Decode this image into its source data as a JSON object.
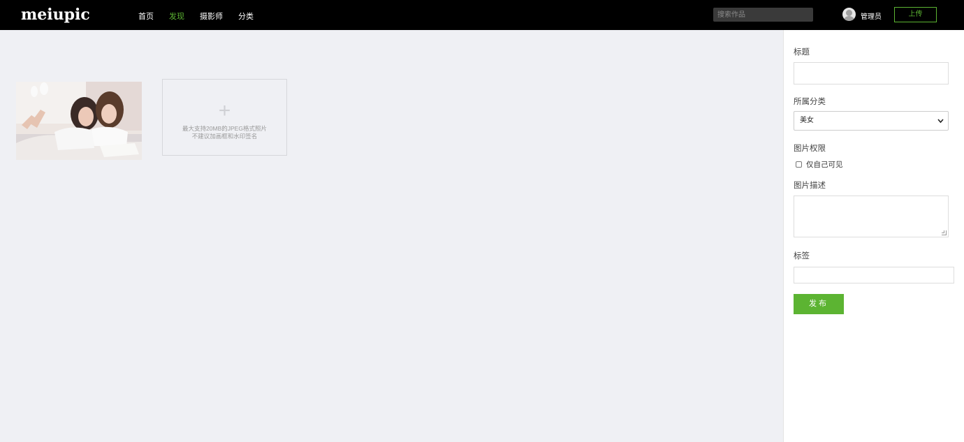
{
  "header": {
    "logo": "meiupic",
    "nav": [
      {
        "label": "首页",
        "active": false
      },
      {
        "label": "发现",
        "active": true
      },
      {
        "label": "摄影师",
        "active": false
      },
      {
        "label": "分类",
        "active": false
      }
    ],
    "search_placeholder": "搜索作品",
    "username": "管理员",
    "upload_label": "上传"
  },
  "upload": {
    "plus": "+",
    "hint_line1": "最大支持20MB的JPEG格式照片",
    "hint_line2": "不建议加画框和水印签名"
  },
  "form": {
    "title_label": "标题",
    "title_value": "",
    "category_label": "所属分类",
    "category_value": "美女",
    "permission_label": "图片权限",
    "private_label": "仅自己可见",
    "private_checked": false,
    "description_label": "图片描述",
    "description_value": "",
    "tags_label": "标签",
    "tags_value": "",
    "publish_label": "发布"
  },
  "colors": {
    "accent": "#5cb432",
    "header_bg": "#000000",
    "page_bg": "#eff0f4"
  },
  "icons": {
    "avatar": "user-avatar-icon",
    "select_arrow": "chevron-down-icon",
    "upload_add": "plus-icon"
  }
}
